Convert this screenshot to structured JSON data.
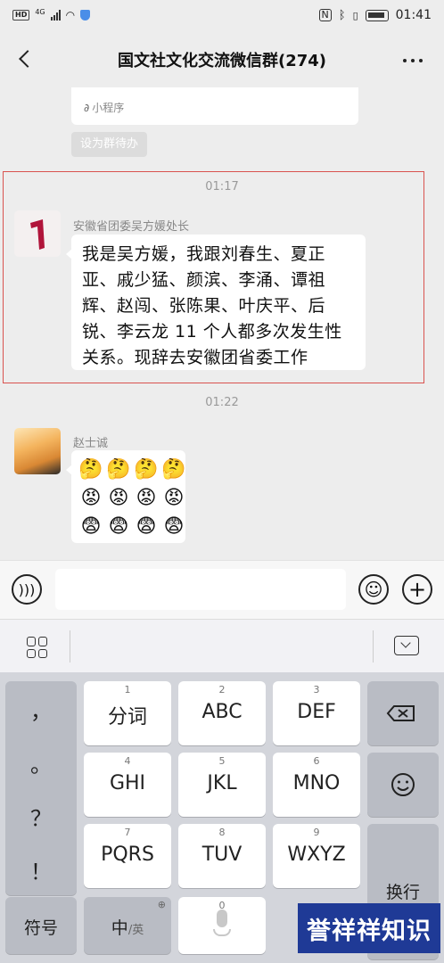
{
  "status_bar": {
    "hd": "HD",
    "network": "4G",
    "nfc": "N",
    "time": "01:41"
  },
  "header": {
    "title": "国文社文化交流微信群(274)"
  },
  "chat": {
    "mini_program_label": "小程序",
    "set_todo_label": "设为群待办",
    "messages": [
      {
        "time": "01:17",
        "sender": "安徽省团委吴方媛处长",
        "lines": [
          "我是吴方媛，我跟刘春生、夏正",
          "亚、戚少猛、颜滨、李涌、谭祖",
          "辉、赵闯、张陈果、叶庆平、后",
          "锐、李云龙 11 个人都多次发生性",
          "关系。现辞去安徽团省委工作"
        ]
      },
      {
        "time": "01:22",
        "sender": "赵士诚",
        "emojis": [
          "🤔",
          "🤔",
          "🤔",
          "🤔",
          "😡",
          "😡",
          "😡",
          "😡",
          "😨",
          "😨",
          "😨",
          "😨"
        ]
      }
    ]
  },
  "input_bar": {
    "voice_icon": "voice-icon",
    "emoji_icon": "emoji-icon",
    "plus_icon": "plus-icon"
  },
  "keyboard": {
    "punct_keys": [
      "，",
      "。",
      "？",
      "！"
    ],
    "keys": [
      {
        "num": "1",
        "label": "分词"
      },
      {
        "num": "2",
        "label": "ABC"
      },
      {
        "num": "3",
        "label": "DEF"
      },
      {
        "num": "4",
        "label": "GHI"
      },
      {
        "num": "5",
        "label": "JKL"
      },
      {
        "num": "6",
        "label": "MNO"
      },
      {
        "num": "7",
        "label": "PQRS"
      },
      {
        "num": "8",
        "label": "TUV"
      },
      {
        "num": "9",
        "label": "WXYZ"
      }
    ],
    "symbol_key": "符号",
    "lang_key_main": "中",
    "lang_key_sub": "/英",
    "zero_key": "0",
    "enter_key": "换行"
  },
  "watermark": "誉祥祥知识"
}
